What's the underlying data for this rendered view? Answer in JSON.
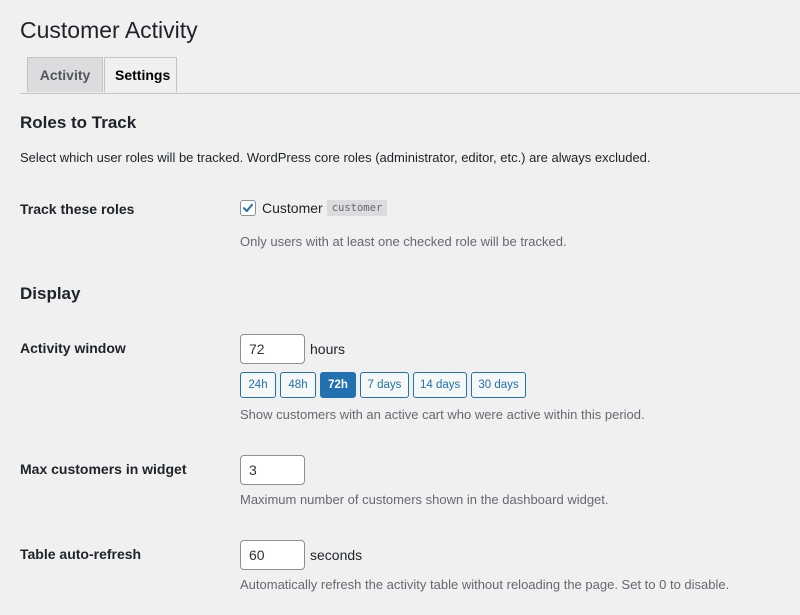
{
  "page": {
    "title": "Customer Activity"
  },
  "tabs": [
    {
      "label": "Activity",
      "active": false
    },
    {
      "label": "Settings",
      "active": true
    }
  ],
  "roles_section": {
    "heading": "Roles to Track",
    "description": "Select which user roles will be tracked. WordPress core roles (administrator, editor, etc.) are always excluded.",
    "row_label": "Track these roles",
    "role": {
      "label": "Customer",
      "slug": "customer",
      "checked": true
    },
    "help": "Only users with at least one checked role will be tracked."
  },
  "display_section": {
    "heading": "Display",
    "activity_window": {
      "label": "Activity window",
      "value": "72",
      "unit": "hours",
      "presets": [
        "24h",
        "48h",
        "72h",
        "7 days",
        "14 days",
        "30 days"
      ],
      "active_preset": "72h",
      "help": "Show customers with an active cart who were active within this period."
    },
    "max_customers": {
      "label": "Max customers in widget",
      "value": "3",
      "help": "Maximum number of customers shown in the dashboard widget."
    },
    "auto_refresh": {
      "label": "Table auto-refresh",
      "value": "60",
      "unit": "seconds",
      "help": "Automatically refresh the activity table without reloading the page. Set to 0 to disable."
    }
  },
  "colors": {
    "accent": "#2271b1",
    "background": "#f0f0f1",
    "text": "#1d2327",
    "muted": "#646970"
  }
}
